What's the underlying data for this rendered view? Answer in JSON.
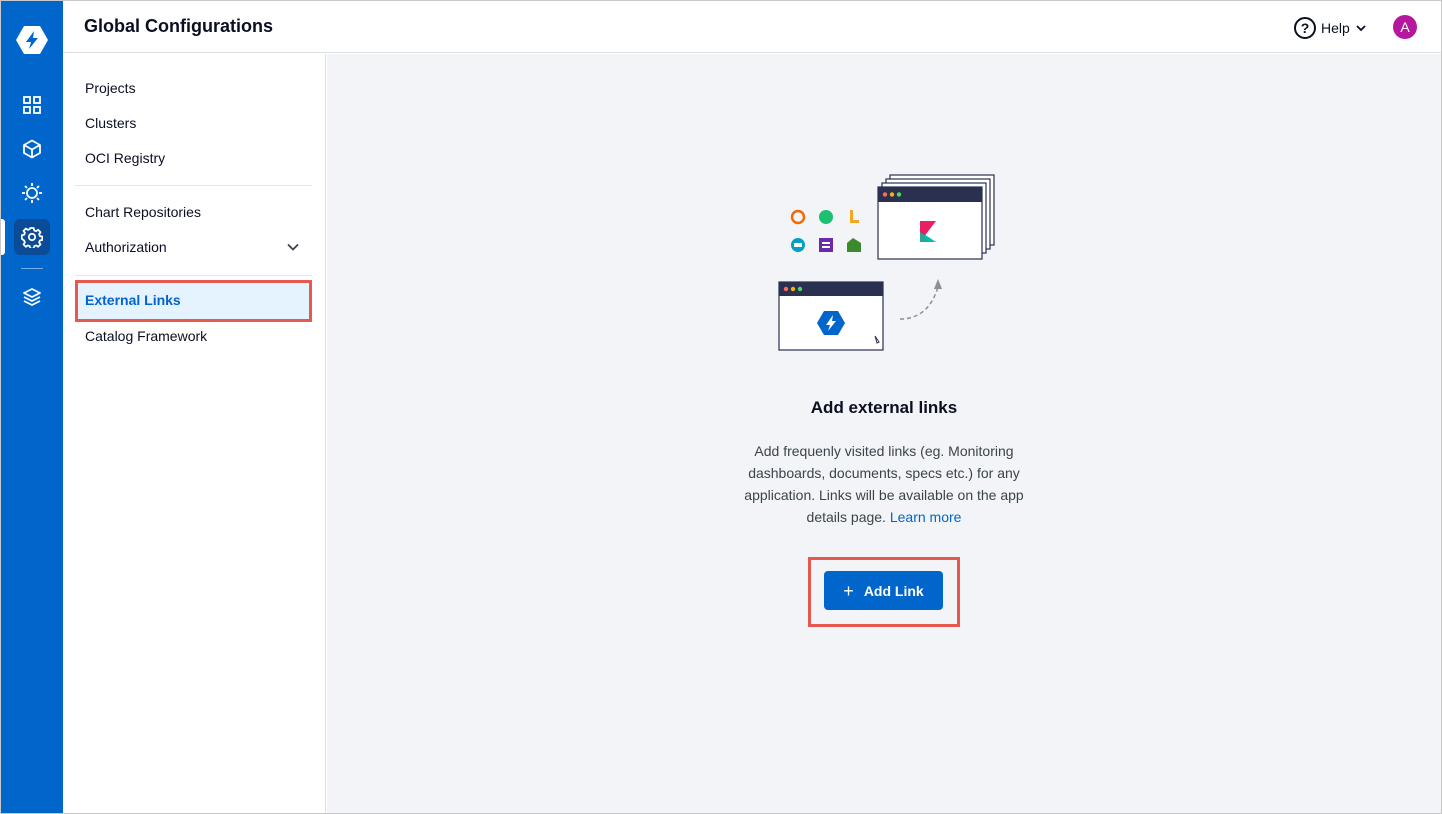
{
  "header": {
    "title": "Global Configurations",
    "help_label": "Help",
    "help_icon_glyph": "?",
    "avatar_initial": "A"
  },
  "rail": {
    "icons": [
      "app-logo-icon",
      "applications-grid-icon",
      "charts-cube-icon",
      "security-gear-icon",
      "settings-gear-icon",
      "stack-layers-icon"
    ]
  },
  "sidebar": {
    "items": [
      {
        "label": "Projects"
      },
      {
        "label": "Clusters"
      },
      {
        "label": "OCI Registry"
      },
      {
        "label": "Chart Repositories"
      },
      {
        "label": "Authorization"
      },
      {
        "label": "External Links"
      },
      {
        "label": "Catalog Framework"
      }
    ],
    "active": "External Links"
  },
  "main": {
    "empty_title": "Add external links",
    "empty_description": "Add frequenly visited links (eg. Monitoring dashboards, documents, specs etc.) for any application. Links will be available on the app details page.",
    "learn_more": "Learn more",
    "add_button_label": "Add Link",
    "add_button_icon": "+"
  },
  "colors": {
    "brand": "#0066cc",
    "highlight": "#e5594f",
    "avatar": "#b5179e"
  }
}
